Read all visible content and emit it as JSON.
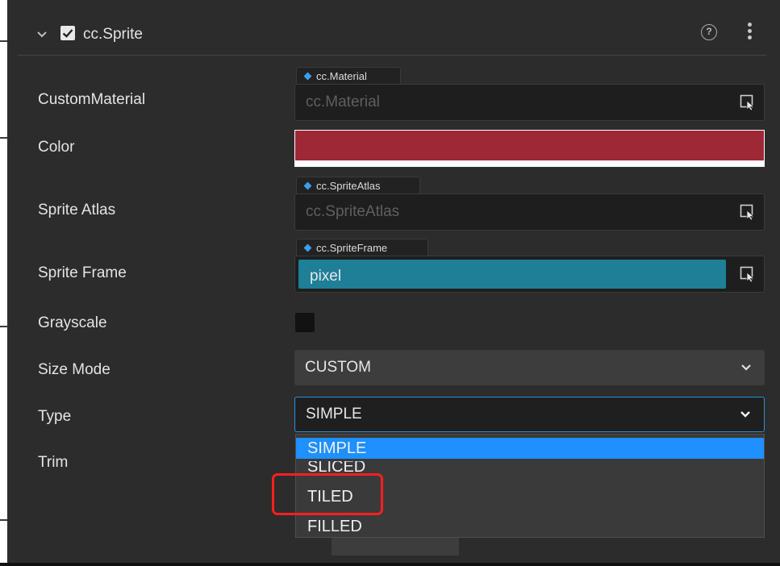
{
  "component": {
    "title": "cc.Sprite",
    "enabled": true,
    "help_icon": "help-icon",
    "menu_icon": "kebab-menu-icon"
  },
  "properties": {
    "custom_material": {
      "label": "CustomMaterial",
      "type_tag": "cc.Material",
      "placeholder": "cc.Material"
    },
    "color": {
      "label": "Color",
      "value_hex": "#9e2836"
    },
    "sprite_atlas": {
      "label": "Sprite Atlas",
      "type_tag": "cc.SpriteAtlas",
      "placeholder": "cc.SpriteAtlas"
    },
    "sprite_frame": {
      "label": "Sprite Frame",
      "type_tag": "cc.SpriteFrame",
      "value": "pixel"
    },
    "grayscale": {
      "label": "Grayscale",
      "checked": false
    },
    "size_mode": {
      "label": "Size Mode",
      "value": "CUSTOM"
    },
    "type": {
      "label": "Type",
      "value": "SIMPLE",
      "open": true,
      "options": [
        "SIMPLE",
        "SLICED",
        "TILED",
        "FILLED"
      ],
      "highlighted": "SIMPLE"
    },
    "trim": {
      "label": "Trim"
    }
  },
  "colors": {
    "accent": "#1e90ff",
    "sprite_frame_fill": "#1e7f97",
    "annotation": "#ff1e1e"
  }
}
